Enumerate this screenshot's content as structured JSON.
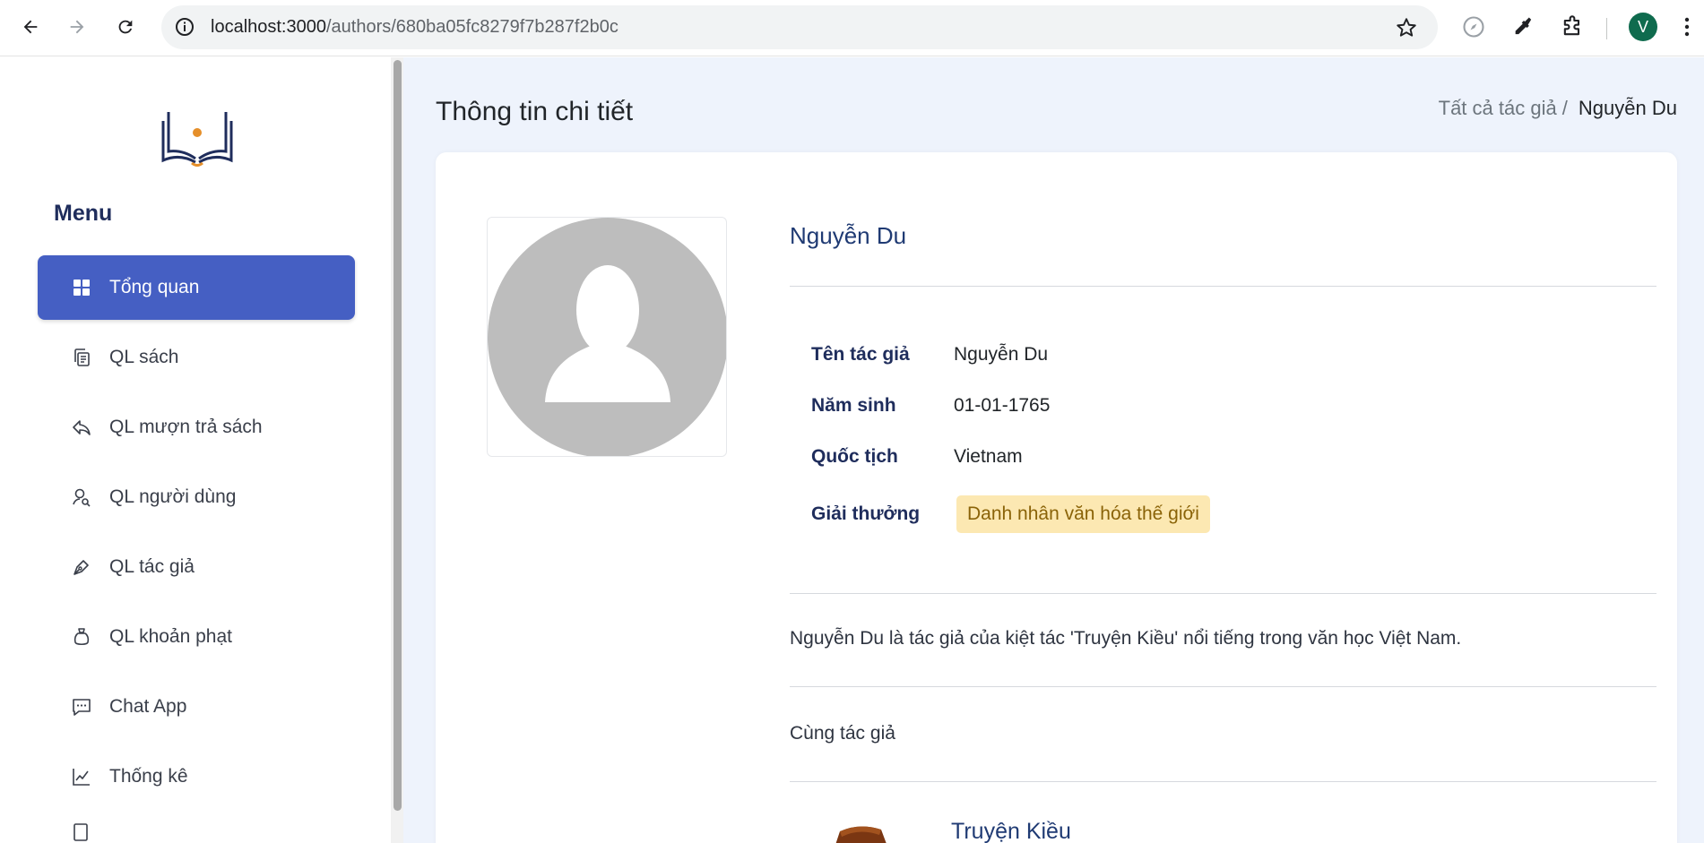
{
  "browser": {
    "url_domain": "localhost:3000",
    "url_path": "/authors/680ba05fc8279f7b287f2b0c",
    "profile_initial": "V",
    "profile_color": "#0f6b4e"
  },
  "sidebar": {
    "menu_title": "Menu",
    "items": [
      {
        "label": "Tổng quan",
        "icon": "grid-icon",
        "active": true
      },
      {
        "label": "QL sách",
        "icon": "copy-icon"
      },
      {
        "label": "QL mượn trả sách",
        "icon": "reply-icon"
      },
      {
        "label": "QL người dùng",
        "icon": "user-search-icon"
      },
      {
        "label": "QL tác giả",
        "icon": "pen-icon"
      },
      {
        "label": "QL khoản phạt",
        "icon": "bag-icon"
      },
      {
        "label": "Chat App",
        "icon": "chat-icon"
      },
      {
        "label": "Thống kê",
        "icon": "chart-icon"
      }
    ]
  },
  "main": {
    "page_title": "Thông tin chi tiết",
    "breadcrumb": {
      "parent": "Tất cả tác giả /",
      "current": "Nguyễn Du"
    },
    "author": {
      "name": "Nguyễn Du",
      "fields": [
        {
          "label": "Tên tác giả",
          "value": "Nguyễn Du"
        },
        {
          "label": "Năm sinh",
          "value": "01-01-1765"
        },
        {
          "label": "Quốc tịch",
          "value": "Vietnam"
        }
      ],
      "award_label": "Giải thưởng",
      "award_value": "Danh nhân văn hóa thế giới",
      "description": "Nguyễn Du là tác giả của kiệt tác 'Truyện Kiều' nổi tiếng trong văn học Việt Nam."
    },
    "same_author_heading": "Cùng tác giả",
    "books": [
      {
        "title": "Truyện Kiều"
      }
    ]
  },
  "colors": {
    "accent": "#455fc3",
    "navy": "#1f2d5c",
    "badge_bg": "#fce8b2",
    "main_bg": "#eef3fc"
  }
}
